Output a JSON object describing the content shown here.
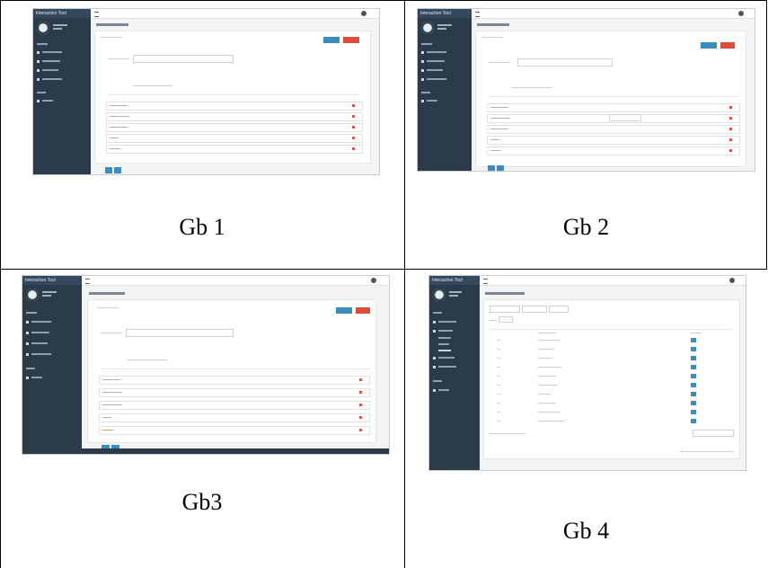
{
  "captions": {
    "gb1": "Gb 1",
    "gb2": "Gb 2",
    "gb3": "Gb3",
    "gb4": "Gb 4"
  },
  "screens": {
    "brand_label": "Interaction Tool",
    "accent_blue": "#3c8dbc",
    "accent_red": "#dd4b39",
    "sidebar_color": "#2c3b49"
  },
  "colors": {
    "grid_line": "#000000",
    "background": "#ffffff"
  }
}
